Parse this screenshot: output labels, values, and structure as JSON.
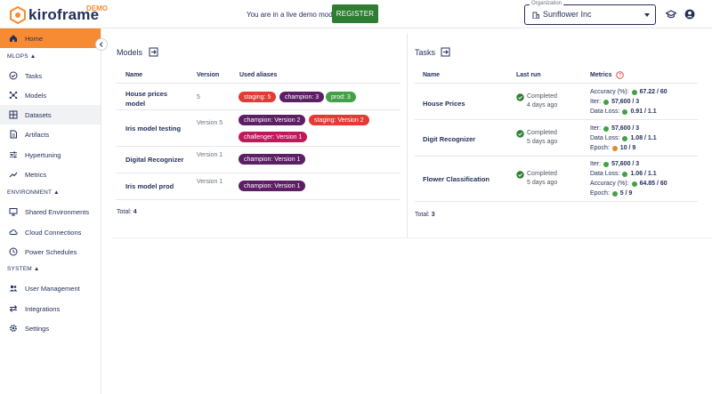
{
  "app": {
    "logo_text": "kiroframe",
    "demo_badge": "DEMO"
  },
  "header": {
    "demo_notice": "You are in a live demo mode",
    "register_label": "REGISTER",
    "organization": {
      "label": "Organization",
      "value": "Sunflower Inc"
    }
  },
  "sidebar": {
    "home": "Home",
    "sections": [
      {
        "label": "MLOPS ▲",
        "items": [
          "Tasks",
          "Models",
          "Datasets",
          "Artifacts",
          "Hypertuning",
          "Metrics"
        ]
      },
      {
        "label": "ENVIRONMENT ▲",
        "items": [
          "Shared Environments",
          "Cloud Connections",
          "Power Schedules"
        ]
      },
      {
        "label": "SYSTEM ▲",
        "items": [
          "User Management",
          "Integrations",
          "Settings"
        ]
      }
    ]
  },
  "models": {
    "title": "Models",
    "headers": [
      "Name",
      "Version",
      "Used aliases"
    ],
    "rows": [
      {
        "name": "House prices model",
        "version": "5",
        "aliases": [
          {
            "label": "staging: 5",
            "color": "#e53935"
          },
          {
            "label": "champion: 3",
            "color": "#5c1e64"
          },
          {
            "label": "prod: 3",
            "color": "#43a047"
          }
        ]
      },
      {
        "name": "Iris model testing",
        "version": "Version 5",
        "aliases": [
          {
            "label": "champion: Version 2",
            "color": "#5c1e64"
          },
          {
            "label": "staging: Version 2",
            "color": "#e53935"
          },
          {
            "label": "challenger: Version 1",
            "color": "#c2185b"
          }
        ]
      },
      {
        "name": "Digital Recognizer",
        "version": "Version 1",
        "aliases": [
          {
            "label": "champion: Version 1",
            "color": "#5c1e64"
          }
        ]
      },
      {
        "name": "Iris model prod",
        "version": "Version 1",
        "aliases": [
          {
            "label": "champion: Version 1",
            "color": "#5c1e64"
          }
        ]
      }
    ],
    "total_label": "Total:",
    "total_value": "4"
  },
  "tasks": {
    "title": "Tasks",
    "headers": [
      "Name",
      "Last run",
      "Metrics"
    ],
    "rows": [
      {
        "name": "House Prices",
        "status": "Completed",
        "when": "4 days ago",
        "metrics": [
          {
            "label": "Accuracy (%):",
            "value": "67.22 / 60",
            "color": "#43a047"
          },
          {
            "label": "Iter:",
            "value": "57,600 / 3",
            "color": "#43a047"
          },
          {
            "label": "Data Loss:",
            "value": "0.91 / 1.1",
            "color": "#43a047"
          }
        ]
      },
      {
        "name": "Digit Recognizer",
        "status": "Completed",
        "when": "5 days ago",
        "metrics": [
          {
            "label": "Iter:",
            "value": "57,600 / 3",
            "color": "#43a047"
          },
          {
            "label": "Data Loss:",
            "value": "1.08 / 1.1",
            "color": "#43a047"
          },
          {
            "label": "Epoch:",
            "value": "10 / 9",
            "color": "#e08a2e"
          }
        ]
      },
      {
        "name": "Flower Classification",
        "status": "Completed",
        "when": "5 days ago",
        "metrics": [
          {
            "label": "Iter:",
            "value": "57,600 / 3",
            "color": "#43a047"
          },
          {
            "label": "Data Loss:",
            "value": "1.06 / 1.1",
            "color": "#43a047"
          },
          {
            "label": "Accuracy (%):",
            "value": "64.85 / 60",
            "color": "#43a047"
          },
          {
            "label": "Epoch:",
            "value": "5 / 9",
            "color": "#43a047"
          }
        ]
      }
    ],
    "total_label": "Total:",
    "total_value": "3"
  }
}
